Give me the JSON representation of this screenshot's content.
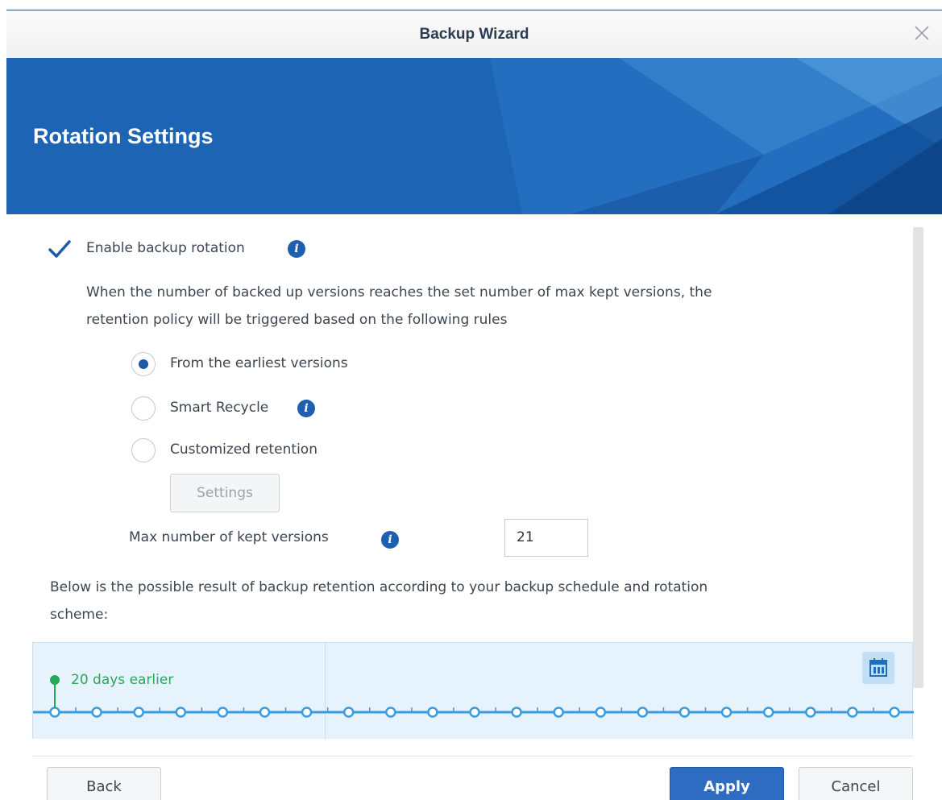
{
  "window": {
    "title": "Backup Wizard",
    "close_icon": "close-icon"
  },
  "banner": {
    "heading": "Rotation Settings"
  },
  "rotation": {
    "enable_label": "Enable backup rotation",
    "enabled": true,
    "description_line1": "When the number of backed up versions reaches the set number of max kept versions, the",
    "description_line2": "retention policy will be triggered based on the following rules",
    "options": [
      {
        "label": "From the earliest versions",
        "selected": true
      },
      {
        "label": "Smart Recycle",
        "selected": false
      },
      {
        "label": "Customized retention",
        "selected": false
      }
    ],
    "settings_button": "Settings",
    "max_versions_label": "Max number of kept versions",
    "max_versions_value": "21"
  },
  "result": {
    "line1": "Below is the possible result of backup retention according to your backup schedule and rotation",
    "line2": "scheme:",
    "earliest_label": "20 days earlier",
    "version_count": 21,
    "calendar_icon": "calendar-icon"
  },
  "footer": {
    "back": "Back",
    "apply": "Apply",
    "cancel": "Cancel"
  },
  "colors": {
    "accent": "#2d6cc0",
    "banner": "#1d63b4",
    "timeline_line": "#3a9ce0",
    "earliest_marker": "#25a85a"
  }
}
